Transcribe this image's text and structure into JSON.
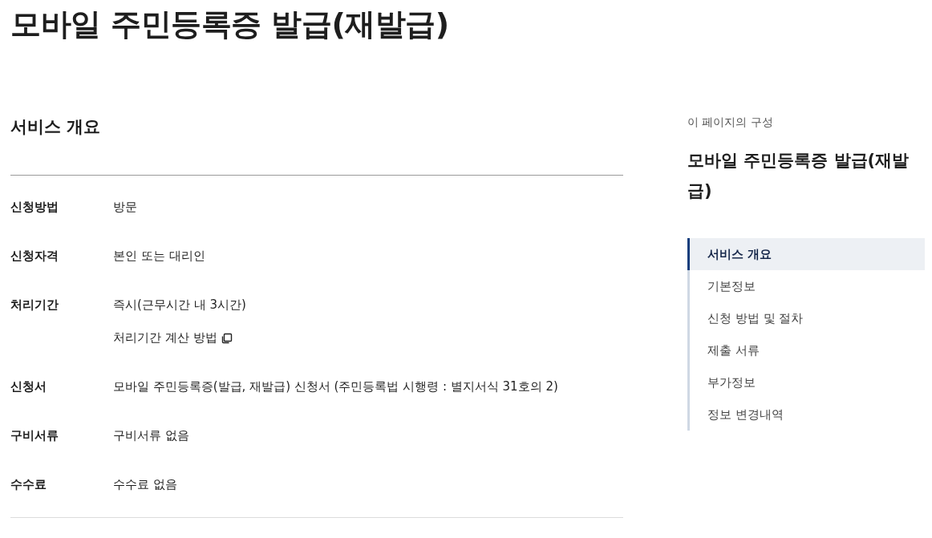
{
  "page_title": "모바일 주민등록증 발급(재발급)",
  "overview": {
    "heading": "서비스 개요",
    "rows": [
      {
        "label": "신청방법",
        "values": [
          {
            "kind": "text",
            "text": "방문"
          }
        ]
      },
      {
        "label": "신청자격",
        "values": [
          {
            "kind": "text",
            "text": "본인 또는 대리인"
          }
        ]
      },
      {
        "label": "처리기간",
        "values": [
          {
            "kind": "text",
            "text": "즉시(근무시간 내 3시간)"
          },
          {
            "kind": "link",
            "text": "처리기간 계산 방법"
          }
        ]
      },
      {
        "label": "신청서",
        "values": [
          {
            "kind": "text",
            "text": "모바일 주민등록증(발급, 재발급) 신청서 (주민등록법 시행령 : 별지서식 31호의 2)"
          }
        ]
      },
      {
        "label": "구비서류",
        "values": [
          {
            "kind": "text",
            "text": "구비서류 없음"
          }
        ]
      },
      {
        "label": "수수료",
        "values": [
          {
            "kind": "text",
            "text": "수수료 없음"
          }
        ]
      }
    ]
  },
  "page_contents": {
    "caption": "이 페이지의 구성",
    "title": "모바일 주민등록증 발급(재발급)",
    "items": [
      {
        "label": "서비스 개요",
        "selected": true
      },
      {
        "label": "기본정보",
        "selected": false
      },
      {
        "label": "신청 방법 및 절차",
        "selected": false
      },
      {
        "label": "제출 서류",
        "selected": false
      },
      {
        "label": "부가정보",
        "selected": false
      },
      {
        "label": "정보 변경내역",
        "selected": false
      }
    ]
  }
}
